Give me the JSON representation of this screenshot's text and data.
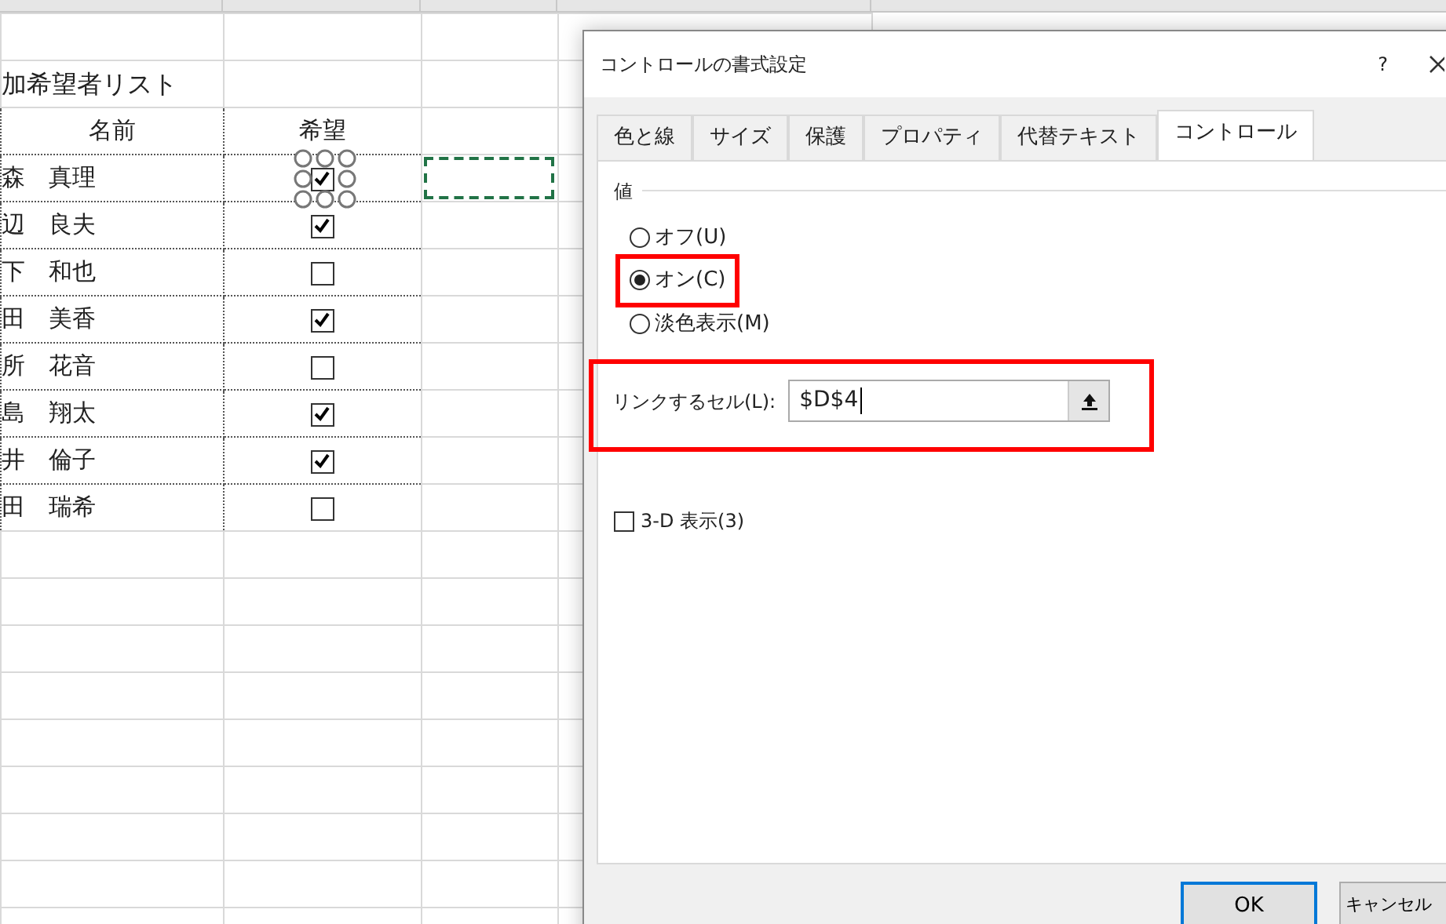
{
  "sheet": {
    "title": "加希望者リスト",
    "columns": [
      "名前",
      "希望"
    ],
    "rows": [
      {
        "name": "森　真理",
        "checked": true,
        "selected": true
      },
      {
        "name": "辺　良夫",
        "checked": true,
        "selected": false
      },
      {
        "name": "下　和也",
        "checked": false,
        "selected": false
      },
      {
        "name": "田　美香",
        "checked": true,
        "selected": false
      },
      {
        "name": "所　花音",
        "checked": false,
        "selected": false
      },
      {
        "name": "島　翔太",
        "checked": true,
        "selected": false
      },
      {
        "name": "井　倫子",
        "checked": true,
        "selected": false
      },
      {
        "name": "田　瑞希",
        "checked": false,
        "selected": false
      }
    ]
  },
  "dialog": {
    "title": "コントロールの書式設定",
    "help": "?",
    "tabs": [
      {
        "label": "色と線",
        "selected": false
      },
      {
        "label": "サイズ",
        "selected": false
      },
      {
        "label": "保護",
        "selected": false
      },
      {
        "label": "プロパティ",
        "selected": false
      },
      {
        "label": "代替テキスト",
        "selected": false
      },
      {
        "label": "コントロール",
        "selected": true
      }
    ],
    "group_label": "値",
    "options": [
      {
        "label": "オフ(U)",
        "selected": false,
        "highlighted": false
      },
      {
        "label": "オン(C)",
        "selected": true,
        "highlighted": true
      },
      {
        "label": "淡色表示(M)",
        "selected": false,
        "highlighted": false
      }
    ],
    "link_cell": {
      "label": "リンクするセル(L):",
      "value": "$D$4",
      "highlighted": true
    },
    "three_d": {
      "label": "3-D 表示(3)",
      "checked": false
    },
    "buttons": [
      "OK",
      "キャンセル"
    ]
  }
}
